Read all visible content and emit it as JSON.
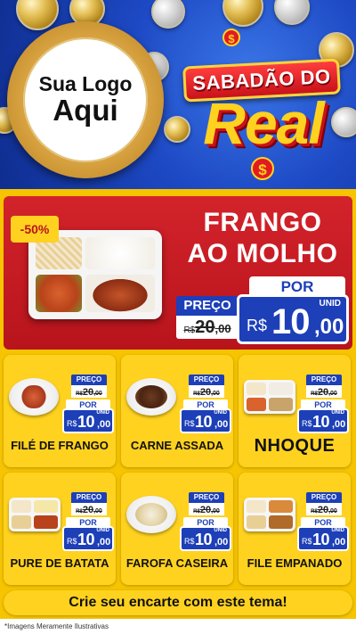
{
  "header": {
    "logo_line1": "Sua Logo",
    "logo_line2": "Aqui",
    "brand_top": "SABADÃO DO",
    "brand_big": "Real",
    "brand_symbol": "$"
  },
  "colors": {
    "blue": "#1d3fb8",
    "red": "#c8121a",
    "yellow": "#ffd21f"
  },
  "featured": {
    "discount": "-50%",
    "title_line1": "FRANGO",
    "title_line2": "AO MOLHO",
    "por_label": "POR",
    "preco_label": "PREÇO",
    "old_currency": "R$",
    "old_value": "20",
    "old_cents": ",00",
    "unid_label": "UNID",
    "new_currency": "R$",
    "new_value": "10",
    "new_cents": ",00"
  },
  "products": [
    {
      "name": "FILÉ DE FRANGO",
      "preco_label": "PREÇO",
      "old_currency": "R$",
      "old_value": "20",
      "old_cents": ",00",
      "por_label": "POR",
      "unid_label": "UNID",
      "new_currency": "R$",
      "new_value": "10",
      "new_cents": ",00"
    },
    {
      "name": "CARNE ASSADA",
      "preco_label": "PREÇO",
      "old_currency": "R$",
      "old_value": "20",
      "old_cents": ",00",
      "por_label": "POR",
      "unid_label": "UNID",
      "new_currency": "R$",
      "new_value": "10",
      "new_cents": ",00"
    },
    {
      "name": "NHOQUE",
      "preco_label": "PREÇO",
      "old_currency": "R$",
      "old_value": "20",
      "old_cents": ",00",
      "por_label": "POR",
      "unid_label": "UNID",
      "new_currency": "R$",
      "new_value": "10",
      "new_cents": ",00"
    },
    {
      "name": "PURE DE BATATA",
      "preco_label": "PREÇO",
      "old_currency": "R$",
      "old_value": "20",
      "old_cents": ",00",
      "por_label": "POR",
      "unid_label": "UNID",
      "new_currency": "R$",
      "new_value": "10",
      "new_cents": ",00"
    },
    {
      "name": "FAROFA CASEIRA",
      "preco_label": "PREÇO",
      "old_currency": "R$",
      "old_value": "20",
      "old_cents": ",00",
      "por_label": "POR",
      "unid_label": "UNID",
      "new_currency": "R$",
      "new_value": "10",
      "new_cents": ",00"
    },
    {
      "name": "FILE EMPANADO",
      "preco_label": "PREÇO",
      "old_currency": "R$",
      "old_value": "20",
      "old_cents": ",00",
      "por_label": "POR",
      "unid_label": "UNID",
      "new_currency": "R$",
      "new_value": "10",
      "new_cents": ",00"
    }
  ],
  "footer": {
    "cta": "Crie seu encarte com este tema!",
    "disclaimer": "*Imagens Meramente Ilustrativas"
  }
}
